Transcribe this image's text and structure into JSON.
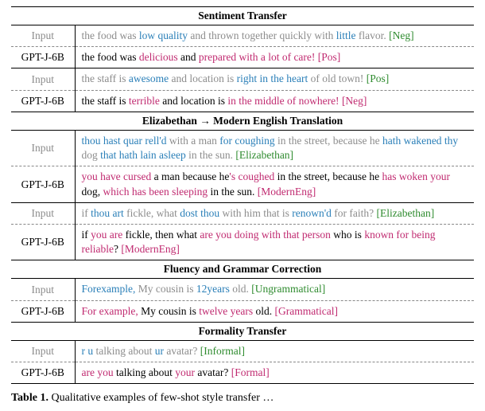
{
  "sections": [
    {
      "title": "Sentiment Transfer",
      "pairs": [
        {
          "input_label": "Input",
          "output_label": "GPT-J-6B",
          "input_segments": [
            {
              "t": "the food was ",
              "c": "txt-input"
            },
            {
              "t": "low quality",
              "c": "seg-in"
            },
            {
              "t": " and thrown together quickly with ",
              "c": "txt-input"
            },
            {
              "t": "little",
              "c": "seg-in"
            },
            {
              "t": " flavor. ",
              "c": "txt-input"
            },
            {
              "t": "[Neg]",
              "c": "tag-in"
            }
          ],
          "output_segments": [
            {
              "t": "the food was ",
              "c": "txt-output"
            },
            {
              "t": "delicious",
              "c": "seg-out"
            },
            {
              "t": " and ",
              "c": "txt-output"
            },
            {
              "t": "prepared with a lot of care!",
              "c": "seg-out"
            },
            {
              "t": " ",
              "c": "txt-output"
            },
            {
              "t": "[Pos]",
              "c": "tag-out"
            }
          ]
        },
        {
          "input_label": "Input",
          "output_label": "GPT-J-6B",
          "input_segments": [
            {
              "t": "the staff is ",
              "c": "txt-input"
            },
            {
              "t": "awesome",
              "c": "seg-in"
            },
            {
              "t": " and location is ",
              "c": "txt-input"
            },
            {
              "t": "right in the heart",
              "c": "seg-in"
            },
            {
              "t": " of old town! ",
              "c": "txt-input"
            },
            {
              "t": "[Pos]",
              "c": "tag-in"
            }
          ],
          "output_segments": [
            {
              "t": "the staff is ",
              "c": "txt-output"
            },
            {
              "t": "terrible",
              "c": "seg-out"
            },
            {
              "t": " and location is ",
              "c": "txt-output"
            },
            {
              "t": "in the middle of nowhere!",
              "c": "seg-out"
            },
            {
              "t": " ",
              "c": "txt-output"
            },
            {
              "t": "[Neg]",
              "c": "tag-out"
            }
          ]
        }
      ]
    },
    {
      "title": "Elizabethan → Modern English Translation",
      "pairs": [
        {
          "input_label": "Input",
          "output_label": "GPT-J-6B",
          "input_segments": [
            {
              "t": "thou hast quar rell'd",
              "c": "seg-in"
            },
            {
              "t": " with a man ",
              "c": "txt-input"
            },
            {
              "t": "for coughing",
              "c": "seg-in"
            },
            {
              "t": " in the street, because he ",
              "c": "txt-input"
            },
            {
              "t": "hath wakened thy",
              "c": "seg-in"
            },
            {
              "t": " dog ",
              "c": "txt-input"
            },
            {
              "t": "that hath lain asleep",
              "c": "seg-in"
            },
            {
              "t": " in the sun. ",
              "c": "txt-input"
            },
            {
              "t": "[Elizabethan]",
              "c": "tag-in"
            }
          ],
          "output_segments": [
            {
              "t": "you have cursed",
              "c": "seg-out"
            },
            {
              "t": " a man because he",
              "c": "txt-output"
            },
            {
              "t": "'s coughed",
              "c": "seg-out"
            },
            {
              "t": " in the street, because he ",
              "c": "txt-output"
            },
            {
              "t": "has woken your",
              "c": "seg-out"
            },
            {
              "t": " dog, ",
              "c": "txt-output"
            },
            {
              "t": "which has been sleeping",
              "c": "seg-out"
            },
            {
              "t": " in the sun. ",
              "c": "txt-output"
            },
            {
              "t": "[ModernEng]",
              "c": "tag-out"
            }
          ]
        },
        {
          "input_label": "Input",
          "output_label": "GPT-J-6B",
          "input_segments": [
            {
              "t": "if ",
              "c": "txt-input"
            },
            {
              "t": "thou art",
              "c": "seg-in"
            },
            {
              "t": " fickle, what ",
              "c": "txt-input"
            },
            {
              "t": "dost thou",
              "c": "seg-in"
            },
            {
              "t": " with him that is ",
              "c": "txt-input"
            },
            {
              "t": "renown'd",
              "c": "seg-in"
            },
            {
              "t": " for faith? ",
              "c": "txt-input"
            },
            {
              "t": "[Elizabethan]",
              "c": "tag-in"
            }
          ],
          "output_segments": [
            {
              "t": "if ",
              "c": "txt-output"
            },
            {
              "t": "you are",
              "c": "seg-out"
            },
            {
              "t": " fickle, then what ",
              "c": "txt-output"
            },
            {
              "t": "are you doing with that person",
              "c": "seg-out"
            },
            {
              "t": " who is ",
              "c": "txt-output"
            },
            {
              "t": "known for being reliable",
              "c": "seg-out"
            },
            {
              "t": "? ",
              "c": "txt-output"
            },
            {
              "t": "[ModernEng]",
              "c": "tag-out"
            }
          ]
        }
      ]
    },
    {
      "title": "Fluency and Grammar Correction",
      "pairs": [
        {
          "input_label": "Input",
          "output_label": "GPT-J-6B",
          "input_segments": [
            {
              "t": "Forexample,",
              "c": "seg-in"
            },
            {
              "t": " My cousin is ",
              "c": "txt-input"
            },
            {
              "t": "12years",
              "c": "seg-in"
            },
            {
              "t": " old. ",
              "c": "txt-input"
            },
            {
              "t": "[Ungrammatical]",
              "c": "tag-in"
            }
          ],
          "output_segments": [
            {
              "t": "For example,",
              "c": "seg-out"
            },
            {
              "t": " My cousin is ",
              "c": "txt-output"
            },
            {
              "t": "twelve years",
              "c": "seg-out"
            },
            {
              "t": " old. ",
              "c": "txt-output"
            },
            {
              "t": "[Grammatical]",
              "c": "tag-out"
            }
          ]
        }
      ]
    },
    {
      "title": "Formality Transfer",
      "pairs": [
        {
          "input_label": "Input",
          "output_label": "GPT-J-6B",
          "input_segments": [
            {
              "t": "r u",
              "c": "seg-in"
            },
            {
              "t": " talking about ",
              "c": "txt-input"
            },
            {
              "t": "ur",
              "c": "seg-in"
            },
            {
              "t": " avatar? ",
              "c": "txt-input"
            },
            {
              "t": "[Informal]",
              "c": "tag-in"
            }
          ],
          "output_segments": [
            {
              "t": "are you",
              "c": "seg-out"
            },
            {
              "t": " talking about ",
              "c": "txt-output"
            },
            {
              "t": "your",
              "c": "seg-out"
            },
            {
              "t": " avatar? ",
              "c": "txt-output"
            },
            {
              "t": "[Formal]",
              "c": "tag-out"
            }
          ]
        }
      ]
    }
  ],
  "caption_label": "Table 1.",
  "caption_text": " Qualitative examples of few-shot style transfer …"
}
